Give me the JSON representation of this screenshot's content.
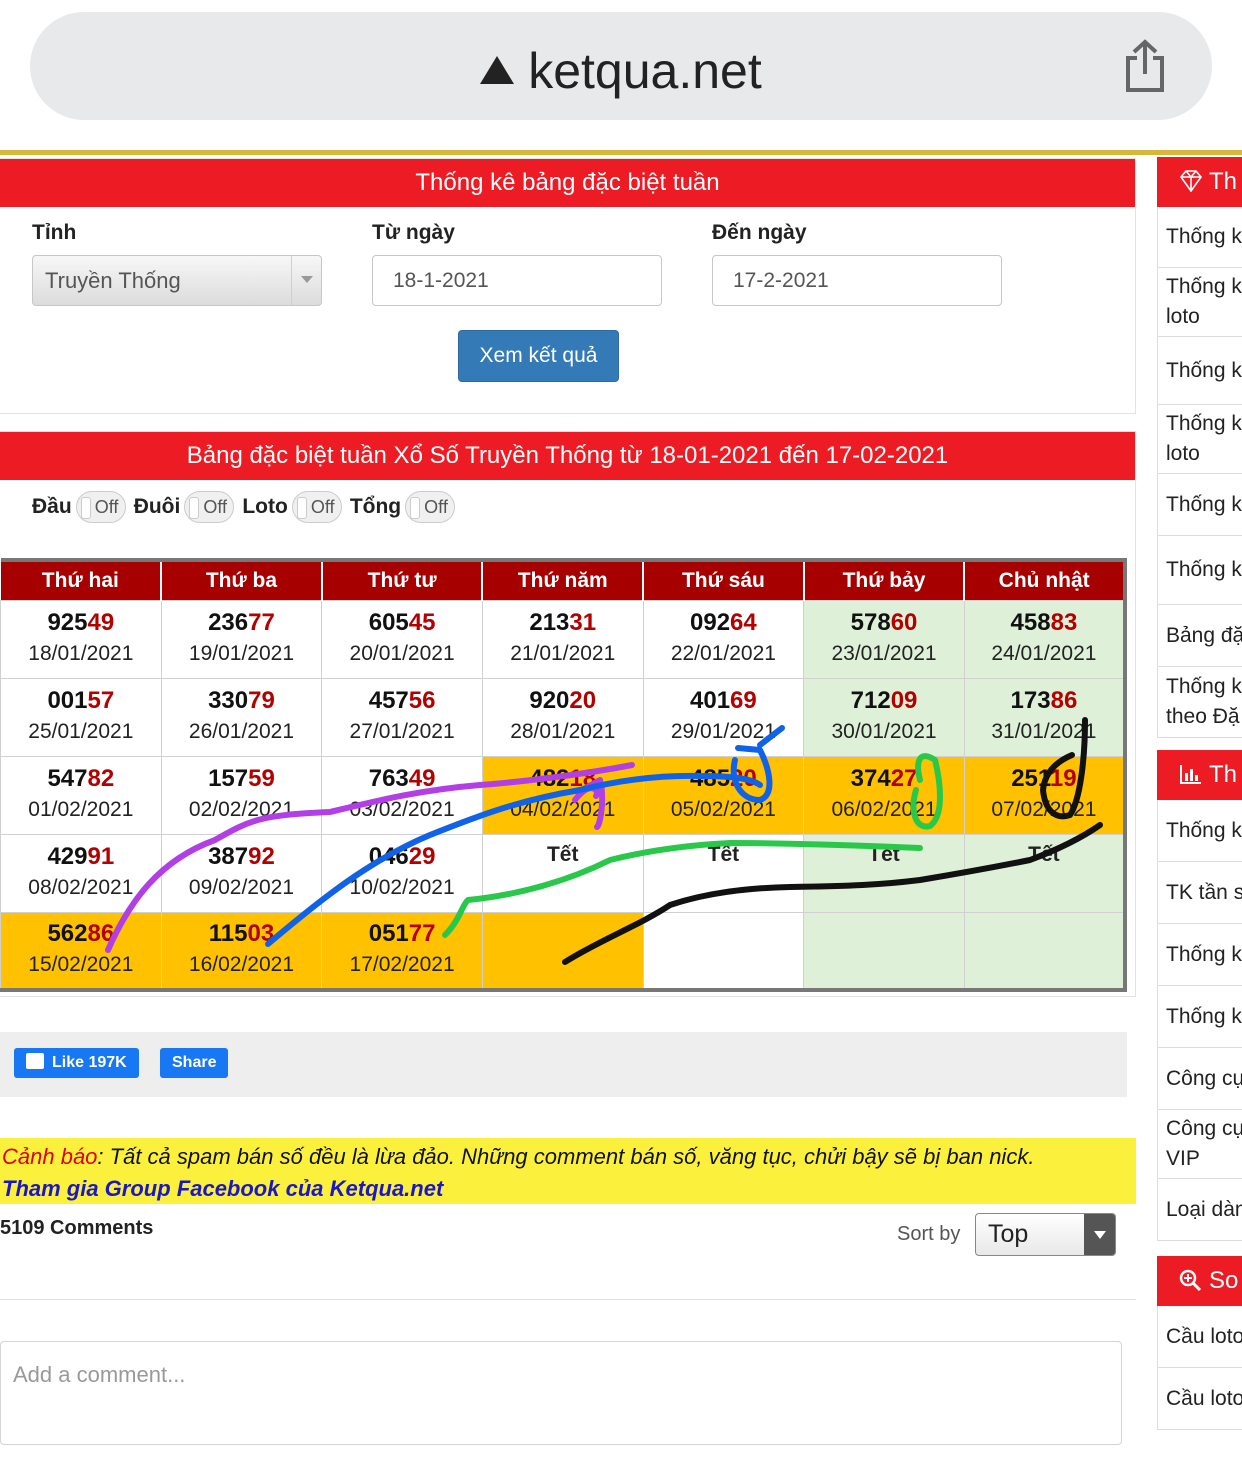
{
  "browser": {
    "url": "ketqua.net"
  },
  "form": {
    "title": "Thống kê bảng đặc biệt tuần",
    "province_label": "Tỉnh",
    "province_value": "Truyền Thống",
    "from_label": "Từ ngày",
    "from_value": "18-1-2021",
    "to_label": "Đến ngày",
    "to_value": "17-2-2021",
    "submit_label": "Xem kết quả"
  },
  "table_section": {
    "title": "Bảng đặc biệt tuần Xổ Số Truyền Thống từ 18-01-2021 đến 17-02-2021",
    "toggles": [
      {
        "label": "Đầu",
        "state": "Off"
      },
      {
        "label": "Đuôi",
        "state": "Off"
      },
      {
        "label": "Loto",
        "state": "Off"
      },
      {
        "label": "Tổng",
        "state": "Off"
      }
    ],
    "headers": [
      "Thứ hai",
      "Thứ ba",
      "Thứ tư",
      "Thứ năm",
      "Thứ sáu",
      "Thứ bảy",
      "Chủ nhật"
    ],
    "rows": [
      [
        {
          "head": "925",
          "tail": "49",
          "date": "18/01/2021"
        },
        {
          "head": "236",
          "tail": "77",
          "date": "19/01/2021"
        },
        {
          "head": "605",
          "tail": "45",
          "date": "20/01/2021"
        },
        {
          "head": "213",
          "tail": "31",
          "date": "21/01/2021"
        },
        {
          "head": "092",
          "tail": "64",
          "date": "22/01/2021"
        },
        {
          "head": "578",
          "tail": "60",
          "date": "23/01/2021"
        },
        {
          "head": "458",
          "tail": "83",
          "date": "24/01/2021"
        }
      ],
      [
        {
          "head": "001",
          "tail": "57",
          "date": "25/01/2021"
        },
        {
          "head": "330",
          "tail": "79",
          "date": "26/01/2021"
        },
        {
          "head": "457",
          "tail": "56",
          "date": "27/01/2021"
        },
        {
          "head": "920",
          "tail": "20",
          "date": "28/01/2021"
        },
        {
          "head": "401",
          "tail": "69",
          "date": "29/01/2021"
        },
        {
          "head": "712",
          "tail": "09",
          "date": "30/01/2021"
        },
        {
          "head": "173",
          "tail": "86",
          "date": "31/01/2021"
        }
      ],
      [
        {
          "head": "547",
          "tail": "82",
          "date": "01/02/2021"
        },
        {
          "head": "157",
          "tail": "59",
          "date": "02/02/2021"
        },
        {
          "head": "763",
          "tail": "49",
          "date": "03/02/2021"
        },
        {
          "head": "482",
          "tail": "18",
          "date": "04/02/2021"
        },
        {
          "head": "485",
          "tail": "20",
          "date": "05/02/2021"
        },
        {
          "head": "374",
          "tail": "27",
          "date": "06/02/2021"
        },
        {
          "head": "251",
          "tail": "19",
          "date": "07/02/2021"
        }
      ],
      [
        {
          "head": "429",
          "tail": "91",
          "date": "08/02/2021"
        },
        {
          "head": "387",
          "tail": "92",
          "date": "09/02/2021"
        },
        {
          "head": "046",
          "tail": "29",
          "date": "10/02/2021"
        },
        {
          "tet": "Tết"
        },
        {
          "tet": "Tết"
        },
        {
          "tet": "Tết"
        },
        {
          "tet": "Tết"
        }
      ],
      [
        {
          "head": "562",
          "tail": "86",
          "date": "15/02/2021"
        },
        {
          "head": "115",
          "tail": "03",
          "date": "16/02/2021"
        },
        {
          "head": "051",
          "tail": "77",
          "date": "17/02/2021"
        },
        {},
        {},
        {},
        {}
      ]
    ]
  },
  "social": {
    "like_label": "Like 197K",
    "share_label": "Share"
  },
  "comments": {
    "warning_prefix": "Cảnh báo",
    "warning_text": ": Tất cả spam bán số đều là lừa đảo. Những comment bán số, văng tục, chửi bậy sẽ bị ban nick.",
    "group_link": "Tham gia Group Facebook của Ketqua.net",
    "count": "5109 Comments",
    "sort_label": "Sort by",
    "sort_value": "Top",
    "placeholder": "Add a comment..."
  },
  "sidebar": {
    "head1": "Th",
    "items1": [
      "Thống k",
      "Thống k\nloto",
      "Thống k",
      "Thống k\nloto",
      "Thống k",
      "Thống k",
      "Bảng đặ",
      "Thống k\ntheo Đặ"
    ],
    "head2": "Th",
    "items2": [
      "Thống k",
      "TK tần s",
      "Thống k",
      "Thống k",
      "Công cụ",
      "Công cụ\nVIP",
      "Loại dàn"
    ],
    "head3": "So",
    "items3": [
      "Cầu loto",
      "Cầu loto"
    ]
  },
  "colors": {
    "brand_red": "#ed1c24",
    "header_red": "#a70000",
    "highlight": "#ffc100",
    "weekend": "#dff0d8",
    "button_blue": "#337ab7"
  }
}
